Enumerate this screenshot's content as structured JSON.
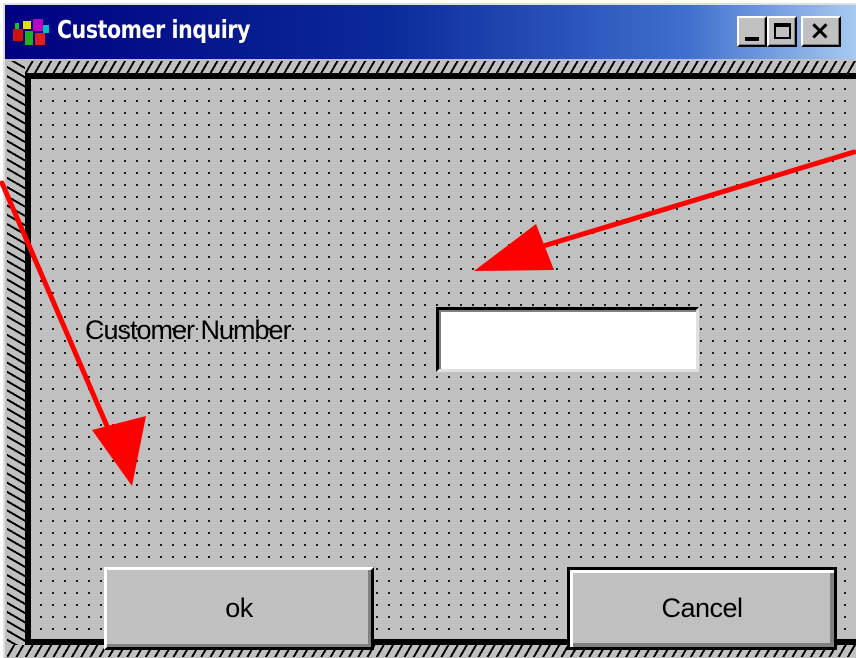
{
  "window": {
    "title": "Customer inquiry",
    "app_icon": "app-icon",
    "controls": {
      "minimize_icon": "minimize-icon",
      "maximize_icon": "maximize-icon",
      "close_glyph": "×"
    }
  },
  "form": {
    "customer_number_label": "Customer Number",
    "customer_number_value": "",
    "ok_label": "ok",
    "cancel_label": "Cancel"
  },
  "annotations": {
    "arrow_color": "#ff0000"
  },
  "colors": {
    "titlebar_start": "#000080",
    "titlebar_end": "#a6caf0",
    "face": "#c0c0c0"
  }
}
